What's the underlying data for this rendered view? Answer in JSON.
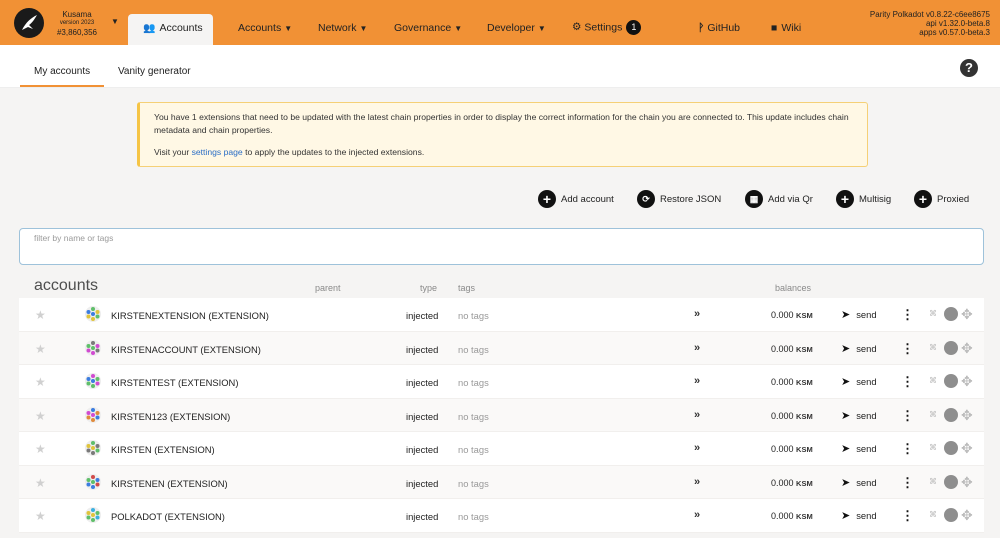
{
  "chain": {
    "name": "Kusama",
    "version": "version 2023",
    "block": "#3,860,356"
  },
  "nav": {
    "active_tab": "Accounts",
    "menus": [
      {
        "label": "Accounts",
        "has_caret": true
      },
      {
        "label": "Network",
        "has_caret": true
      },
      {
        "label": "Governance",
        "has_caret": true
      },
      {
        "label": "Developer",
        "has_caret": true
      }
    ],
    "settings": {
      "label": "Settings",
      "badge": "1"
    },
    "github": "GitHub",
    "wiki": "Wiki"
  },
  "version_info": {
    "line1": "Parity Polkadot v0.8.22-c6ee8675",
    "line2": "api v1.32.0-beta.8",
    "line3": "apps v0.57.0-beta.3"
  },
  "subtabs": [
    "My accounts",
    "Vanity generator"
  ],
  "banner": {
    "text1": "You have 1 extensions that need to be updated with the latest chain properties in order to display the correct information for the chain you are connected to. This update includes chain metadata and chain properties.",
    "text2_prefix": "Visit your ",
    "link": "settings page",
    "text2_suffix": " to apply the updates to the injected extensions."
  },
  "actions": [
    "Add account",
    "Restore JSON",
    "Add via Qr",
    "Multisig",
    "Proxied"
  ],
  "filter": {
    "placeholder": "filter by name or tags",
    "value": ""
  },
  "table": {
    "title": "accounts",
    "headers": {
      "parent": "parent",
      "type": "type",
      "tags": "tags",
      "balances": "balances"
    },
    "rows": [
      {
        "name": "KIRSTENEXTENSION (EXTENSION)",
        "type": "injected",
        "tags": "no tags",
        "balance": "0.000",
        "unit": "KSM",
        "send": "send"
      },
      {
        "name": "KIRSTENACCOUNT (EXTENSION)",
        "type": "injected",
        "tags": "no tags",
        "balance": "0.000",
        "unit": "KSM",
        "send": "send"
      },
      {
        "name": "KIRSTENTEST (EXTENSION)",
        "type": "injected",
        "tags": "no tags",
        "balance": "0.000",
        "unit": "KSM",
        "send": "send"
      },
      {
        "name": "KIRSTEN123 (EXTENSION)",
        "type": "injected",
        "tags": "no tags",
        "balance": "0.000",
        "unit": "KSM",
        "send": "send"
      },
      {
        "name": "KIRSTEN (EXTENSION)",
        "type": "injected",
        "tags": "no tags",
        "balance": "0.000",
        "unit": "KSM",
        "send": "send"
      },
      {
        "name": "KIRSTENEN (EXTENSION)",
        "type": "injected",
        "tags": "no tags",
        "balance": "0.000",
        "unit": "KSM",
        "send": "send"
      },
      {
        "name": "POLKADOT (EXTENSION)",
        "type": "injected",
        "tags": "no tags",
        "balance": "0.000",
        "unit": "KSM",
        "send": "send"
      }
    ]
  },
  "colors": {
    "topbar": "#f19135",
    "background": "#f5f4f3",
    "banner": "#fff8e5",
    "link": "#2a6dc5"
  },
  "icons": [
    "kusama-logo-icon",
    "users-icon",
    "gears-icon",
    "github-icon",
    "book-icon",
    "help-icon",
    "plus-icon",
    "sync-icon",
    "qrcode-icon",
    "star-icon",
    "identicon-icon",
    "paper-plane-icon",
    "ellipsis-icon",
    "network-icon"
  ]
}
